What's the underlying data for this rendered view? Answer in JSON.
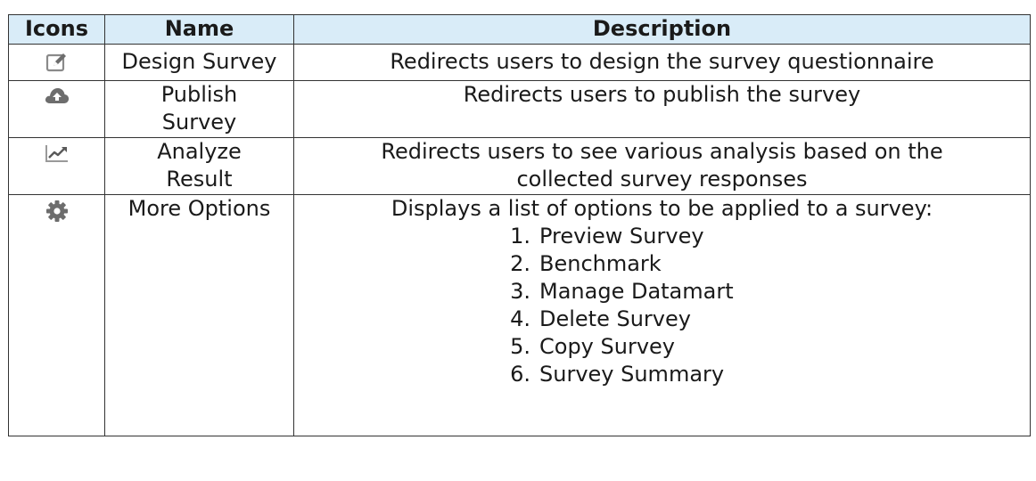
{
  "table": {
    "headers": {
      "icons": "Icons",
      "name": "Name",
      "description": "Description"
    },
    "rows": [
      {
        "icon": "edit-icon",
        "name": "Design Survey",
        "description": "Redirects users to design the survey questionnaire"
      },
      {
        "icon": "cloud-upload-icon",
        "name_line1": "Publish",
        "name_line2": "Survey",
        "description": "Redirects users to publish the survey"
      },
      {
        "icon": "line-chart-icon",
        "name_line1": "Analyze",
        "name_line2": "Result",
        "description_line1": "Redirects users to see various analysis based on the",
        "description_line2": "collected survey responses"
      },
      {
        "icon": "gear-icon",
        "name": "More Options",
        "description": "Displays a list of options to be applied to a survey:",
        "options": [
          {
            "num": "1.",
            "label": "Preview Survey"
          },
          {
            "num": "2.",
            "label": "Benchmark"
          },
          {
            "num": "3.",
            "label": "Manage Datamart"
          },
          {
            "num": "4.",
            "label": "Delete Survey"
          },
          {
            "num": "5.",
            "label": "Copy Survey"
          },
          {
            "num": "6.",
            "label": "Survey Summary"
          }
        ]
      }
    ]
  },
  "colors": {
    "header_bg": "#d9ecf8",
    "border": "#333333",
    "icon_gray": "#6d6d6d"
  }
}
